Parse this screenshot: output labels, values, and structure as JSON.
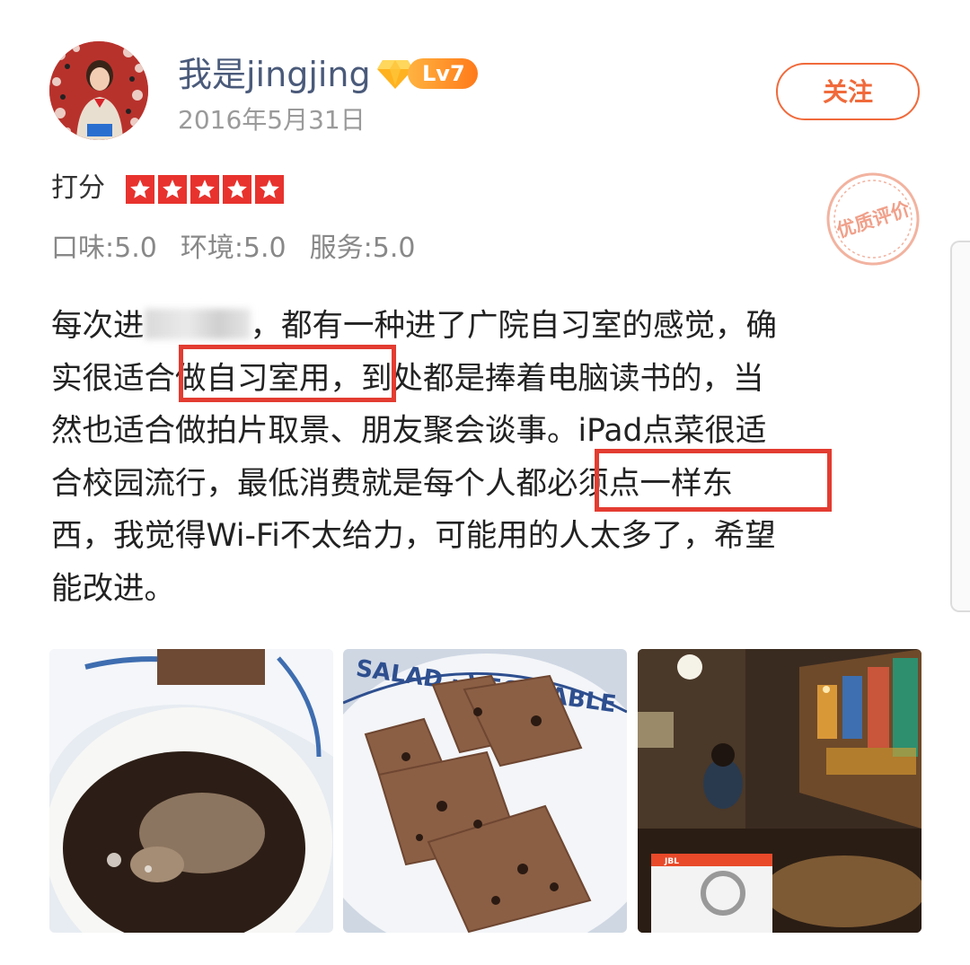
{
  "user": {
    "name": "我是jingjing",
    "level": "Lv7",
    "date": "2016年5月31日"
  },
  "actions": {
    "follow_label": "关注"
  },
  "rating": {
    "label": "打分",
    "stars": 5,
    "subscores": [
      "口味:5.0",
      "环境:5.0",
      "服务:5.0"
    ]
  },
  "stamp_text": "优质评价",
  "review": {
    "line1_a": "每次进",
    "line1_b": "，都有一种进了广院自习室的感觉，确",
    "line2": "实很适合做自习室用，到处都是捧着电脑读书的，当",
    "line3": "然也适合做拍片取景、朋友聚会谈事。iPad点菜很适",
    "line4": "合校园流行，最低消费就是每个人都必须点一样东",
    "line5": "西，我觉得Wi-Fi不太给力，可能用的人太多了，希望",
    "line6": "能改进。"
  },
  "photos": {
    "photo2_plate_text": "SALAD · VEGETABLE",
    "photo3_box_brand": "JBL"
  },
  "colors": {
    "accent": "#f06a3b",
    "star": "#e8322d",
    "highlight_box": "#e33c31",
    "username": "#4a5a7a"
  },
  "icons": [
    "avatar",
    "diamond-level-icon",
    "star-icon",
    "quality-stamp-icon"
  ]
}
